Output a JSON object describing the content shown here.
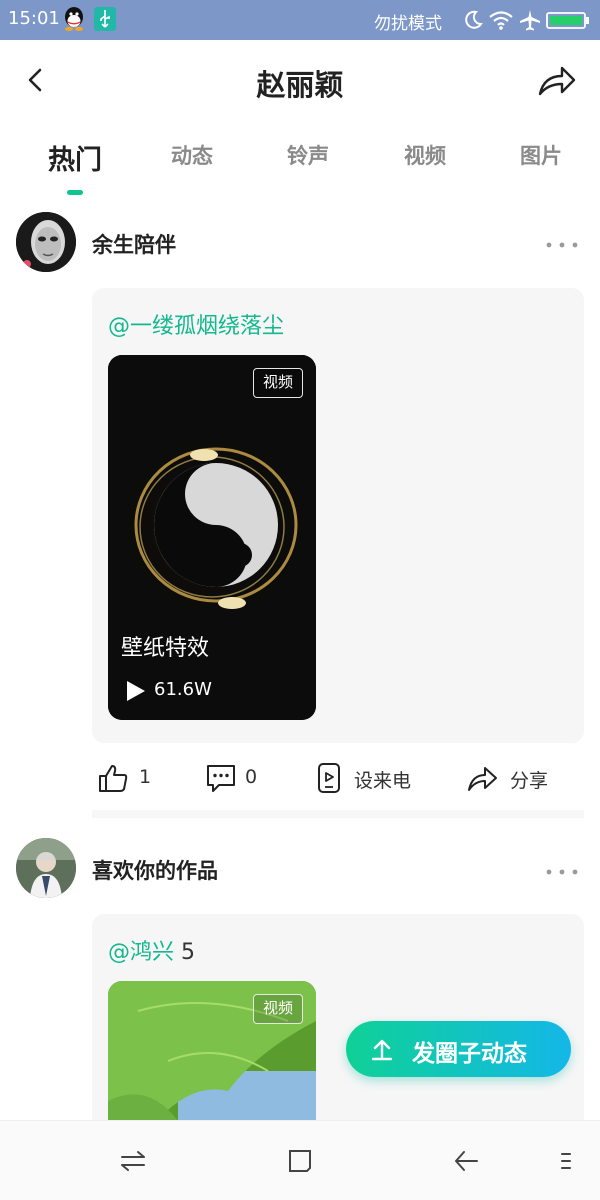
{
  "status_bar": {
    "time": "15:01",
    "mode_text": "勿扰模式",
    "icons": [
      "qq-icon",
      "usb-icon",
      "moon-icon",
      "wifi-icon",
      "airplane-icon",
      "battery-icon"
    ]
  },
  "header": {
    "title": "赵丽颖",
    "back_icon": "chevron-left-icon",
    "share_icon": "share-icon"
  },
  "tabs": [
    {
      "label": "热门",
      "active": true
    },
    {
      "label": "动态",
      "active": false
    },
    {
      "label": "铃声",
      "active": false
    },
    {
      "label": "视频",
      "active": false
    },
    {
      "label": "图片",
      "active": false
    }
  ],
  "posts": [
    {
      "username": "余生陪伴",
      "mention": "@一缕孤烟绕落尘",
      "mention_extra": "",
      "media": {
        "badge": "视频",
        "title": "壁纸特效",
        "play_count": "61.6W"
      },
      "actions": {
        "likes": "1",
        "comments": "0",
        "set_ringtone": "设来电",
        "share": "分享"
      }
    },
    {
      "username": "喜欢你的作品",
      "mention": "@鸿兴",
      "mention_extra": " 5",
      "media": {
        "badge": "视频"
      }
    }
  ],
  "fab": {
    "label": "发圈子动态",
    "icon": "upload-icon"
  },
  "nav_bar": {
    "icons": [
      "switch-icon",
      "home-square-icon",
      "back-arrow-icon",
      "menu-icon"
    ]
  },
  "colors": {
    "accent": "#10c48f",
    "status_bar": "#7d97c8",
    "fab_start": "#0fd196",
    "fab_end": "#14b7e8"
  }
}
